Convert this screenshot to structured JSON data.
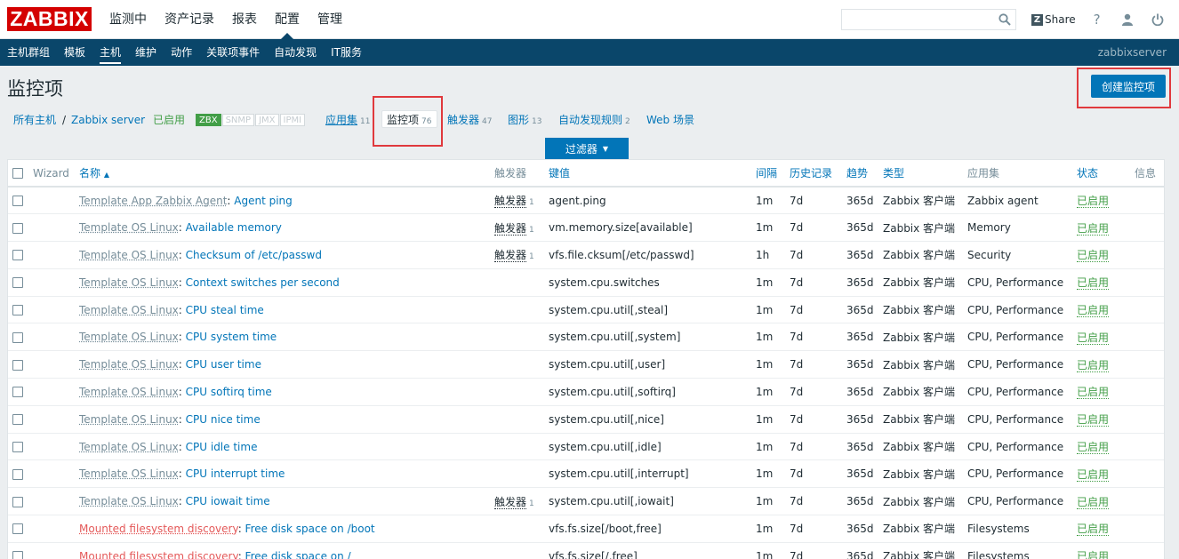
{
  "logo": "ZABBIX",
  "top_menu": [
    "监测中",
    "资产记录",
    "报表",
    "配置",
    "管理"
  ],
  "top_menu_active": 3,
  "top_right": {
    "share_label": "Share",
    "help": "?"
  },
  "search": {
    "value": "",
    "placeholder": ""
  },
  "sub_menu": [
    "主机群组",
    "模板",
    "主机",
    "维护",
    "动作",
    "关联项事件",
    "自动发现",
    "IT服务"
  ],
  "sub_menu_active": 2,
  "server_name": "zabbixserver",
  "page_title": "监控项",
  "create_button": "创建监控项",
  "host_nav": {
    "all_hosts": "所有主机",
    "separator": "/",
    "host": "Zabbix server",
    "enabled": "已启用",
    "tags": [
      "ZBX",
      "SNMP",
      "JMX",
      "IPMI"
    ],
    "applications": {
      "label": "应用集",
      "count": "11"
    },
    "items": {
      "label": "监控项",
      "count": "76"
    },
    "triggers": {
      "label": "触发器",
      "count": "47"
    },
    "graphs": {
      "label": "图形",
      "count": "13"
    },
    "discovery": {
      "label": "自动发现规则",
      "count": "2"
    },
    "web": {
      "label": "Web 场景"
    }
  },
  "filter_label": "过滤器",
  "table": {
    "headers": {
      "wizard": "Wizard",
      "name": "名称",
      "triggers": "触发器",
      "key": "键值",
      "interval": "间隔",
      "history": "历史记录",
      "trends": "趋势",
      "type": "类型",
      "applications": "应用集",
      "status": "状态",
      "info": "信息"
    },
    "rows": [
      {
        "template": "Template App Zabbix Agent",
        "name": "Agent ping",
        "triggers": "触发器",
        "trigger_count": "1",
        "key": "agent.ping",
        "interval": "1m",
        "history": "7d",
        "trends": "365d",
        "type": "Zabbix 客户端",
        "app": "Zabbix agent",
        "status": "已启用"
      },
      {
        "template": "Template OS Linux",
        "name": "Available memory",
        "triggers": "触发器",
        "trigger_count": "1",
        "key": "vm.memory.size[available]",
        "interval": "1m",
        "history": "7d",
        "trends": "365d",
        "type": "Zabbix 客户端",
        "app": "Memory",
        "status": "已启用"
      },
      {
        "template": "Template OS Linux",
        "name": "Checksum of /etc/passwd",
        "triggers": "触发器",
        "trigger_count": "1",
        "key": "vfs.file.cksum[/etc/passwd]",
        "interval": "1h",
        "history": "7d",
        "trends": "365d",
        "type": "Zabbix 客户端",
        "app": "Security",
        "status": "已启用"
      },
      {
        "template": "Template OS Linux",
        "name": "Context switches per second",
        "triggers": "",
        "trigger_count": "",
        "key": "system.cpu.switches",
        "interval": "1m",
        "history": "7d",
        "trends": "365d",
        "type": "Zabbix 客户端",
        "app": "CPU, Performance",
        "status": "已启用"
      },
      {
        "template": "Template OS Linux",
        "name": "CPU steal time",
        "triggers": "",
        "trigger_count": "",
        "key": "system.cpu.util[,steal]",
        "interval": "1m",
        "history": "7d",
        "trends": "365d",
        "type": "Zabbix 客户端",
        "app": "CPU, Performance",
        "status": "已启用"
      },
      {
        "template": "Template OS Linux",
        "name": "CPU system time",
        "triggers": "",
        "trigger_count": "",
        "key": "system.cpu.util[,system]",
        "interval": "1m",
        "history": "7d",
        "trends": "365d",
        "type": "Zabbix 客户端",
        "app": "CPU, Performance",
        "status": "已启用"
      },
      {
        "template": "Template OS Linux",
        "name": "CPU user time",
        "triggers": "",
        "trigger_count": "",
        "key": "system.cpu.util[,user]",
        "interval": "1m",
        "history": "7d",
        "trends": "365d",
        "type": "Zabbix 客户端",
        "app": "CPU, Performance",
        "status": "已启用"
      },
      {
        "template": "Template OS Linux",
        "name": "CPU softirq time",
        "triggers": "",
        "trigger_count": "",
        "key": "system.cpu.util[,softirq]",
        "interval": "1m",
        "history": "7d",
        "trends": "365d",
        "type": "Zabbix 客户端",
        "app": "CPU, Performance",
        "status": "已启用"
      },
      {
        "template": "Template OS Linux",
        "name": "CPU nice time",
        "triggers": "",
        "trigger_count": "",
        "key": "system.cpu.util[,nice]",
        "interval": "1m",
        "history": "7d",
        "trends": "365d",
        "type": "Zabbix 客户端",
        "app": "CPU, Performance",
        "status": "已启用"
      },
      {
        "template": "Template OS Linux",
        "name": "CPU idle time",
        "triggers": "",
        "trigger_count": "",
        "key": "system.cpu.util[,idle]",
        "interval": "1m",
        "history": "7d",
        "trends": "365d",
        "type": "Zabbix 客户端",
        "app": "CPU, Performance",
        "status": "已启用"
      },
      {
        "template": "Template OS Linux",
        "name": "CPU interrupt time",
        "triggers": "",
        "trigger_count": "",
        "key": "system.cpu.util[,interrupt]",
        "interval": "1m",
        "history": "7d",
        "trends": "365d",
        "type": "Zabbix 客户端",
        "app": "CPU, Performance",
        "status": "已启用"
      },
      {
        "template": "Template OS Linux",
        "name": "CPU iowait time",
        "triggers": "触发器",
        "trigger_count": "1",
        "key": "system.cpu.util[,iowait]",
        "interval": "1m",
        "history": "7d",
        "trends": "365d",
        "type": "Zabbix 客户端",
        "app": "CPU, Performance",
        "status": "已启用"
      },
      {
        "template": "Mounted filesystem discovery",
        "template_kind": "discovery",
        "name": "Free disk space on /boot",
        "triggers": "",
        "trigger_count": "",
        "key": "vfs.fs.size[/boot,free]",
        "interval": "1m",
        "history": "7d",
        "trends": "365d",
        "type": "Zabbix 客户端",
        "app": "Filesystems",
        "status": "已启用"
      },
      {
        "template": "Mounted filesystem discovery",
        "template_kind": "discovery",
        "name": "Free disk space on /",
        "triggers": "",
        "trigger_count": "",
        "key": "vfs.fs.size[/,free]",
        "interval": "1m",
        "history": "7d",
        "trends": "365d",
        "type": "Zabbix 客户端",
        "app": "Filesystems",
        "status": "已启用"
      }
    ]
  },
  "colors": {
    "brand": "#d40000",
    "nav_bg": "#0a466a",
    "link": "#0275b8",
    "enabled": "#429e47",
    "discovery": "#e45959",
    "highlight": "#e0393d"
  }
}
